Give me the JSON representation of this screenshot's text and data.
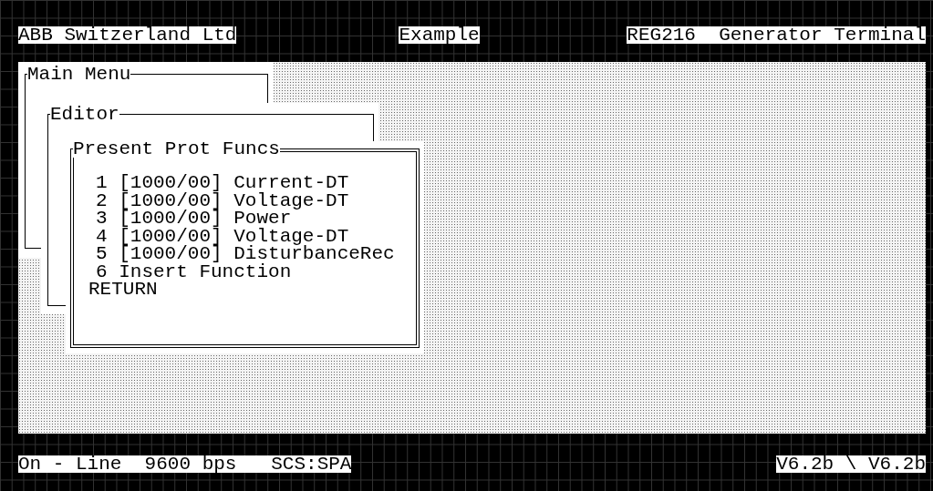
{
  "header": {
    "left": "ABB Switzerland Ltd",
    "center": "Example",
    "right": "REG216  Generator Terminal"
  },
  "windows": [
    {
      "title": "Main Menu",
      "kind": "single"
    },
    {
      "title": "Editor",
      "kind": "single"
    },
    {
      "title": "Present Prot Funcs",
      "kind": "double",
      "items": [
        {
          "kind": "function",
          "text": "1 [1000/00] Current-DT"
        },
        {
          "kind": "function",
          "text": "2 [1000/00] Voltage-DT"
        },
        {
          "kind": "function",
          "text": "3 [1000/00] Power"
        },
        {
          "kind": "function",
          "text": "4 [1000/00] Voltage-DT"
        },
        {
          "kind": "function",
          "text": "5 [1000/00] DisturbanceRec"
        },
        {
          "kind": "function",
          "text": "6 Insert Function"
        },
        {
          "kind": "return",
          "text": "RETURN"
        }
      ]
    }
  ],
  "status_bar": {
    "left": "On - Line  9600 bps   SCS:SPA",
    "right": "V6.2b \\ V6.2b"
  }
}
